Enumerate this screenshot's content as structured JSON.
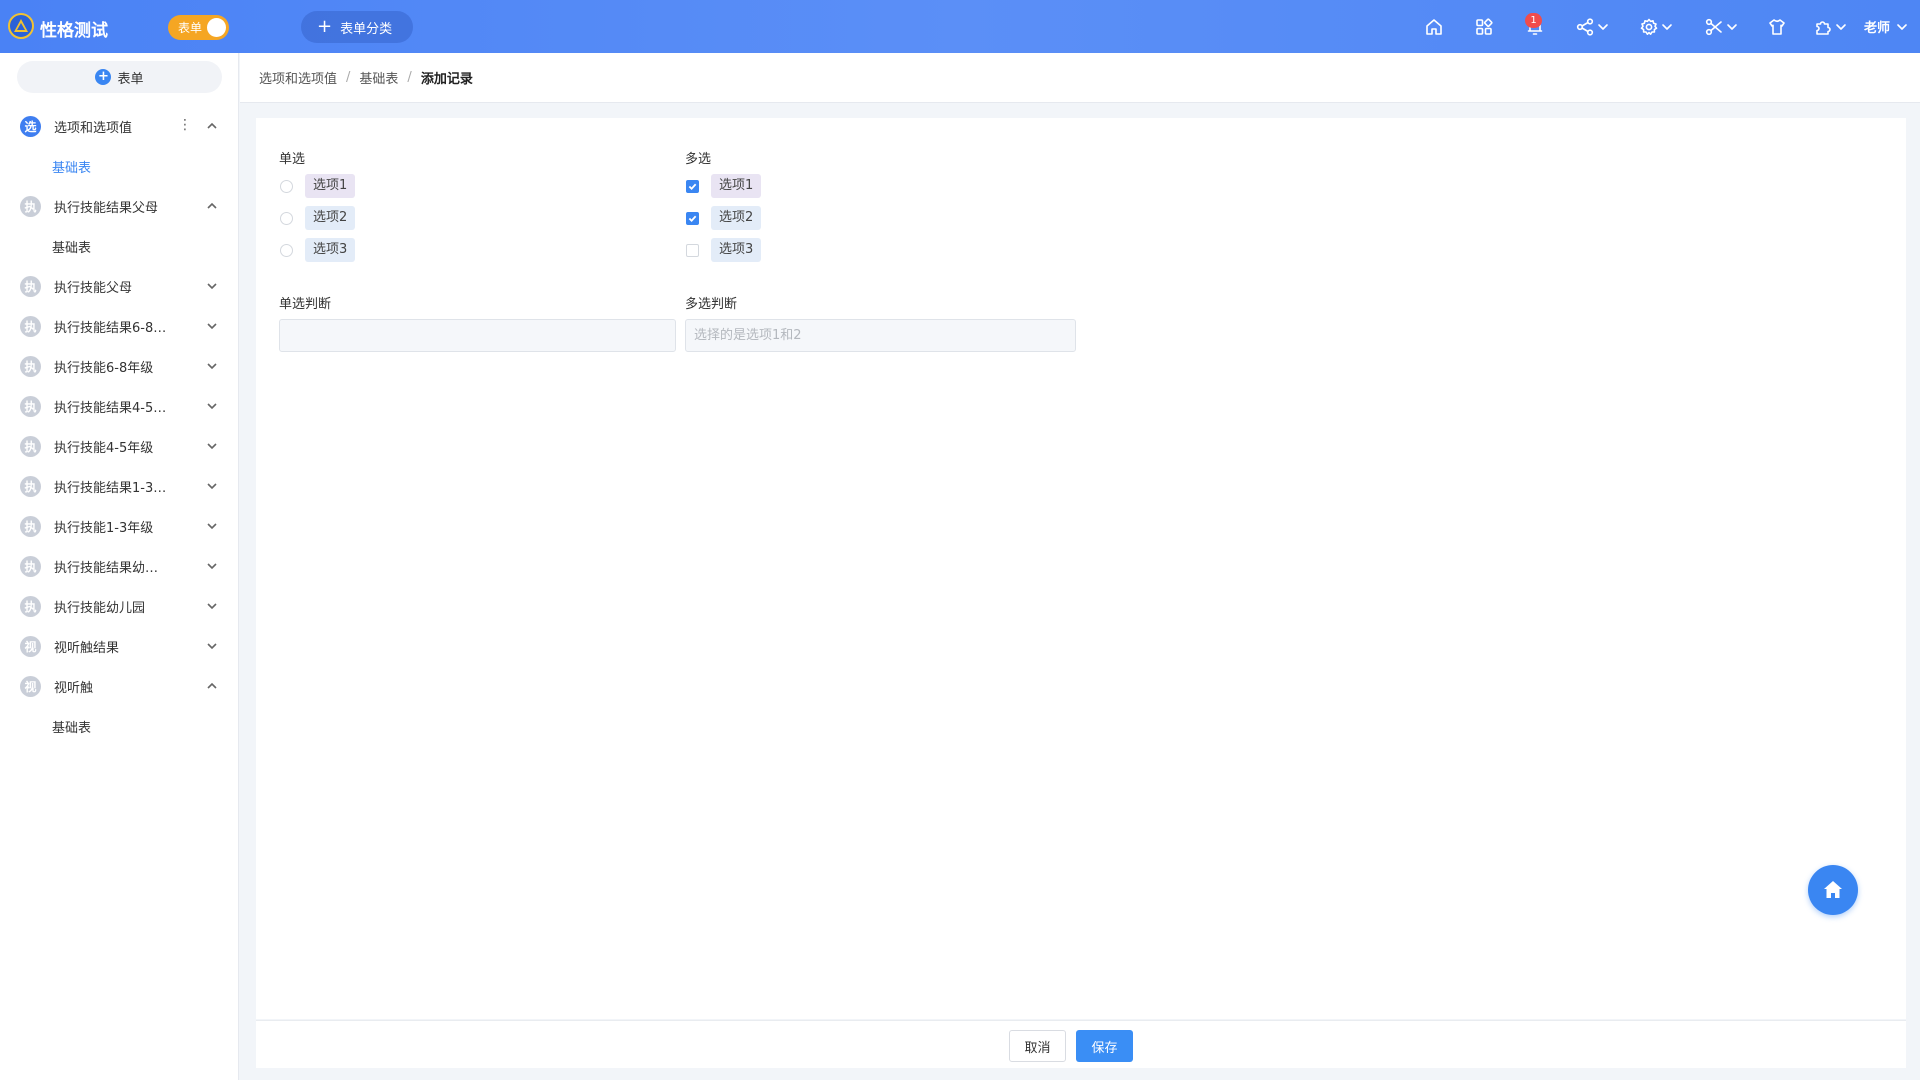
{
  "app": {
    "title": "性格测试",
    "toggle_label": "表单",
    "add_category_label": "表单分类"
  },
  "header": {
    "notification_count": "1",
    "user_name": "老师"
  },
  "sidebar": {
    "add_label": "表单",
    "items": [
      {
        "avatar": "选",
        "label": "选项和选项值",
        "active": true,
        "expanded": true,
        "children": [
          {
            "label": "基础表",
            "active": true
          }
        ]
      },
      {
        "avatar": "执",
        "label": "执行技能结果父母",
        "expanded": true,
        "children": [
          {
            "label": "基础表"
          }
        ]
      },
      {
        "avatar": "执",
        "label": "执行技能父母"
      },
      {
        "avatar": "执",
        "label": "执行技能结果6-8…"
      },
      {
        "avatar": "执",
        "label": "执行技能6-8年级"
      },
      {
        "avatar": "执",
        "label": "执行技能结果4-5…"
      },
      {
        "avatar": "执",
        "label": "执行技能4-5年级"
      },
      {
        "avatar": "执",
        "label": "执行技能结果1-3…"
      },
      {
        "avatar": "执",
        "label": "执行技能1-3年级"
      },
      {
        "avatar": "执",
        "label": "执行技能结果幼…"
      },
      {
        "avatar": "执",
        "label": "执行技能幼儿园"
      },
      {
        "avatar": "视",
        "label": "视听触结果"
      },
      {
        "avatar": "视",
        "label": "视听触",
        "expanded": true,
        "children": [
          {
            "label": "基础表"
          }
        ]
      }
    ]
  },
  "breadcrumb": [
    "选项和选项值",
    "基础表",
    "添加记录"
  ],
  "form": {
    "single_label": "单选",
    "single_options": [
      {
        "label": "选项1",
        "checked": false
      },
      {
        "label": "选项2",
        "checked": false
      },
      {
        "label": "选项3",
        "checked": false
      }
    ],
    "multi_label": "多选",
    "multi_options": [
      {
        "label": "选项1",
        "checked": true
      },
      {
        "label": "选项2",
        "checked": true
      },
      {
        "label": "选项3",
        "checked": false
      }
    ],
    "single_judge_label": "单选判断",
    "single_judge_value": "",
    "multi_judge_label": "多选判断",
    "multi_judge_value": "选择的是选项1和2"
  },
  "footer": {
    "cancel_label": "取消",
    "save_label": "保存"
  },
  "colors": {
    "primary": "#3a86f2",
    "header_start": "#4a82f5",
    "toggle": "#f5a623",
    "badge": "#f04c4c"
  }
}
